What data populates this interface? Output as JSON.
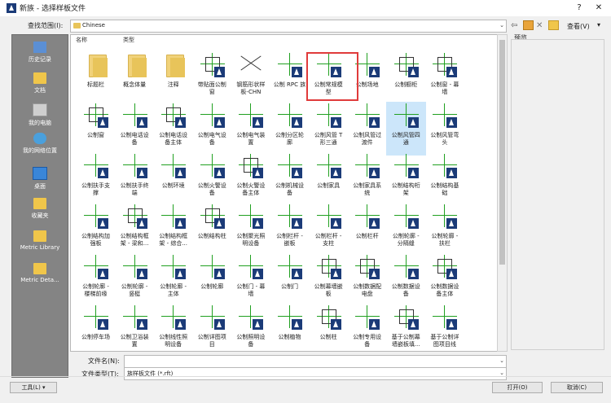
{
  "window": {
    "title": "新族 - 选择样板文件",
    "help_label": "?",
    "close_label": "✕"
  },
  "lookin": {
    "label": "查找范围(I):",
    "value": "Chinese"
  },
  "toolbar": {
    "view_label": "查看(V)"
  },
  "columns": {
    "name": "名称",
    "type": "类型"
  },
  "preview_label": "预览",
  "sidebar": {
    "items": [
      {
        "label": "历史记录",
        "icon": "history-icon"
      },
      {
        "label": "文档",
        "icon": "documents-folder-icon"
      },
      {
        "label": "我的电脑",
        "icon": "computer-icon"
      },
      {
        "label": "我的网络位置",
        "icon": "network-icon"
      },
      {
        "label": "桌面",
        "icon": "desktop-icon"
      },
      {
        "label": "收藏夹",
        "icon": "favorites-folder-icon"
      },
      {
        "label": "Metric Library",
        "icon": "folder-icon"
      },
      {
        "label": "Metric Deta...",
        "icon": "folder-icon"
      }
    ]
  },
  "files": [
    {
      "label": "标题栏",
      "kind": "folder"
    },
    {
      "label": "概念体量",
      "kind": "folder"
    },
    {
      "label": "注释",
      "kind": "folder"
    },
    {
      "label": "带贴面公制\n窗",
      "kind": "window"
    },
    {
      "label": "钢筋形状样\n板-CHN",
      "kind": "rebar"
    },
    {
      "label": "公制 RPC 族",
      "kind": "template"
    },
    {
      "label": "公制常规模\n型",
      "kind": "template"
    },
    {
      "label": "公制场地",
      "kind": "template"
    },
    {
      "label": "公制橱柜",
      "kind": "box"
    },
    {
      "label": "公制窗 - 幕\n墙",
      "kind": "window"
    },
    {
      "label": "公制窗",
      "kind": "window"
    },
    {
      "label": "公制电话设\n备",
      "kind": "template"
    },
    {
      "label": "公制电话设\n备主体",
      "kind": "box"
    },
    {
      "label": "公制电气设\n备",
      "kind": "template"
    },
    {
      "label": "公制电气装\n置",
      "kind": "template"
    },
    {
      "label": "公制分区轮\n廓",
      "kind": "template"
    },
    {
      "label": "公制风管 T\n形三通",
      "kind": "template"
    },
    {
      "label": "公制风管过\n渡件",
      "kind": "template"
    },
    {
      "label": "公制风管四\n通",
      "kind": "template",
      "selected": true
    },
    {
      "label": "公制风管弯\n头",
      "kind": "template"
    },
    {
      "label": "公制扶手支\n撑",
      "kind": "template"
    },
    {
      "label": "公制扶手终\n端",
      "kind": "template"
    },
    {
      "label": "公制环境",
      "kind": "template"
    },
    {
      "label": "公制火警设\n备",
      "kind": "template"
    },
    {
      "label": "公制火警设\n备主体",
      "kind": "box"
    },
    {
      "label": "公制机械设\n备",
      "kind": "template"
    },
    {
      "label": "公制家具",
      "kind": "template"
    },
    {
      "label": "公制家具系\n统",
      "kind": "template"
    },
    {
      "label": "公制结构桁\n架",
      "kind": "template"
    },
    {
      "label": "公制结构基\n础",
      "kind": "template"
    },
    {
      "label": "公制结构加\n强板",
      "kind": "template"
    },
    {
      "label": "公制结构框\n架 - 梁和...",
      "kind": "window"
    },
    {
      "label": "公制结构框\n架 - 综合...",
      "kind": "template"
    },
    {
      "label": "公制结构柱",
      "kind": "window"
    },
    {
      "label": "公制聚光照\n明设备",
      "kind": "template"
    },
    {
      "label": "公制栏杆 -\n嵌板",
      "kind": "template"
    },
    {
      "label": "公制栏杆 -\n支柱",
      "kind": "template"
    },
    {
      "label": "公制栏杆",
      "kind": "template"
    },
    {
      "label": "公制轮廓 -\n分隔缝",
      "kind": "template"
    },
    {
      "label": "公制轮廓 -\n扶栏",
      "kind": "template"
    },
    {
      "label": "公制轮廓 -\n楼梯前缘",
      "kind": "template"
    },
    {
      "label": "公制轮廓 -\n竖梃",
      "kind": "template"
    },
    {
      "label": "公制轮廓 -\n主体",
      "kind": "template"
    },
    {
      "label": "公制轮廓",
      "kind": "template"
    },
    {
      "label": "公制门 - 幕\n墙",
      "kind": "template"
    },
    {
      "label": "公制门",
      "kind": "template"
    },
    {
      "label": "公制幕墙嵌\n板",
      "kind": "box"
    },
    {
      "label": "公制数据配\n电盘",
      "kind": "box"
    },
    {
      "label": "公制数据设\n备",
      "kind": "template"
    },
    {
      "label": "公制数据设\n备主体",
      "kind": "box"
    },
    {
      "label": "公制停车场",
      "kind": "template"
    },
    {
      "label": "公制卫浴装\n置",
      "kind": "template"
    },
    {
      "label": "公制线性照\n明设备",
      "kind": "template"
    },
    {
      "label": "公制详图项\n目",
      "kind": "template"
    },
    {
      "label": "公制照明设\n备",
      "kind": "template"
    },
    {
      "label": "公制植物",
      "kind": "template"
    },
    {
      "label": "公制柱",
      "kind": "box"
    },
    {
      "label": "公制专用设\n备",
      "kind": "template"
    },
    {
      "label": "基于公制幕\n墙嵌板填...",
      "kind": "box"
    },
    {
      "label": "基于公制详\n图项目线",
      "kind": "template"
    }
  ],
  "filename": {
    "label": "文件名(N):",
    "value": ""
  },
  "filetype": {
    "label": "文件类型(T):",
    "value": "族样板文件 (*.rft)"
  },
  "buttons": {
    "tools": "工具(L)",
    "open": "打开(O)",
    "cancel": "取消(C)"
  }
}
